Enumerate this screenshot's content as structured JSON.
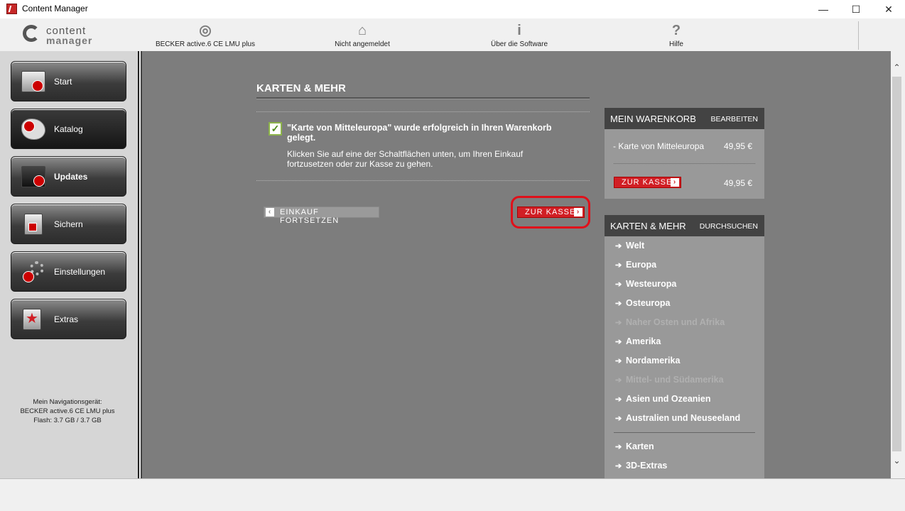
{
  "window": {
    "title": "Content Manager"
  },
  "logo": {
    "line1": "content",
    "line2": "manager"
  },
  "toolbar": {
    "device": "BECKER active.6 CE LMU plus",
    "login": "Nicht angemeldet",
    "about": "Über die Software",
    "help": "Hilfe"
  },
  "sidebar": {
    "items": [
      {
        "label": "Start"
      },
      {
        "label": "Katalog"
      },
      {
        "label": "Updates"
      },
      {
        "label": "Sichern"
      },
      {
        "label": "Einstellungen"
      },
      {
        "label": "Extras"
      }
    ],
    "device_info": {
      "line1": "Mein Navigationsgerät:",
      "line2": "BECKER active.6 CE LMU plus",
      "line3": "Flash: 3.7 GB / 3.7 GB"
    }
  },
  "main": {
    "heading": "KARTEN & MEHR",
    "success_message": "\"Karte von Mitteleuropa\" wurde erfolgreich in Ihren Warenkorb gelegt.",
    "success_hint": "Klicken Sie auf eine der Schaltflächen unten, um Ihren Einkauf fortzusetzen oder zur Kasse zu gehen.",
    "continue_label": "EINKAUF FORTSETZEN",
    "checkout_label": "ZUR KASSE"
  },
  "cart": {
    "title": "MEIN WARENKORB",
    "edit": "BEARBEITEN",
    "item": "- Karte von Mitteleuropa",
    "price": "49,95 €",
    "checkout": "ZUR KASSE",
    "total": "49,95 €"
  },
  "catalog": {
    "title": "KARTEN & MEHR",
    "browse": "DURCHSUCHEN",
    "items": [
      {
        "label": "Welt"
      },
      {
        "label": "Europa"
      },
      {
        "label": "Westeuropa"
      },
      {
        "label": "Osteuropa"
      },
      {
        "label": "Naher Osten und Afrika"
      },
      {
        "label": "Amerika"
      },
      {
        "label": "Nordamerika"
      },
      {
        "label": "Mittel- und Südamerika"
      },
      {
        "label": "Asien und Ozeanien"
      },
      {
        "label": "Australien und Neuseeland"
      }
    ],
    "extra_items": [
      {
        "label": "Karten"
      },
      {
        "label": "3D-Extras"
      }
    ]
  },
  "colors": {
    "accent_red": "#d11f25",
    "main_bg": "#7d7d7d",
    "panel_head": "#434343",
    "panel_body": "#999999"
  }
}
